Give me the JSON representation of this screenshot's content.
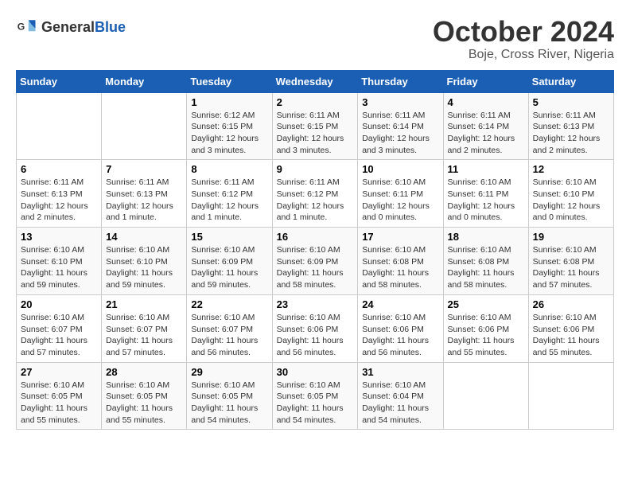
{
  "logo": {
    "general": "General",
    "blue": "Blue"
  },
  "title": "October 2024",
  "subtitle": "Boje, Cross River, Nigeria",
  "days_header": [
    "Sunday",
    "Monday",
    "Tuesday",
    "Wednesday",
    "Thursday",
    "Friday",
    "Saturday"
  ],
  "weeks": [
    [
      {
        "day": "",
        "info": ""
      },
      {
        "day": "",
        "info": ""
      },
      {
        "day": "1",
        "info": "Sunrise: 6:12 AM\nSunset: 6:15 PM\nDaylight: 12 hours and 3 minutes."
      },
      {
        "day": "2",
        "info": "Sunrise: 6:11 AM\nSunset: 6:15 PM\nDaylight: 12 hours and 3 minutes."
      },
      {
        "day": "3",
        "info": "Sunrise: 6:11 AM\nSunset: 6:14 PM\nDaylight: 12 hours and 3 minutes."
      },
      {
        "day": "4",
        "info": "Sunrise: 6:11 AM\nSunset: 6:14 PM\nDaylight: 12 hours and 2 minutes."
      },
      {
        "day": "5",
        "info": "Sunrise: 6:11 AM\nSunset: 6:13 PM\nDaylight: 12 hours and 2 minutes."
      }
    ],
    [
      {
        "day": "6",
        "info": "Sunrise: 6:11 AM\nSunset: 6:13 PM\nDaylight: 12 hours and 2 minutes."
      },
      {
        "day": "7",
        "info": "Sunrise: 6:11 AM\nSunset: 6:13 PM\nDaylight: 12 hours and 1 minute."
      },
      {
        "day": "8",
        "info": "Sunrise: 6:11 AM\nSunset: 6:12 PM\nDaylight: 12 hours and 1 minute."
      },
      {
        "day": "9",
        "info": "Sunrise: 6:11 AM\nSunset: 6:12 PM\nDaylight: 12 hours and 1 minute."
      },
      {
        "day": "10",
        "info": "Sunrise: 6:10 AM\nSunset: 6:11 PM\nDaylight: 12 hours and 0 minutes."
      },
      {
        "day": "11",
        "info": "Sunrise: 6:10 AM\nSunset: 6:11 PM\nDaylight: 12 hours and 0 minutes."
      },
      {
        "day": "12",
        "info": "Sunrise: 6:10 AM\nSunset: 6:10 PM\nDaylight: 12 hours and 0 minutes."
      }
    ],
    [
      {
        "day": "13",
        "info": "Sunrise: 6:10 AM\nSunset: 6:10 PM\nDaylight: 11 hours and 59 minutes."
      },
      {
        "day": "14",
        "info": "Sunrise: 6:10 AM\nSunset: 6:10 PM\nDaylight: 11 hours and 59 minutes."
      },
      {
        "day": "15",
        "info": "Sunrise: 6:10 AM\nSunset: 6:09 PM\nDaylight: 11 hours and 59 minutes."
      },
      {
        "day": "16",
        "info": "Sunrise: 6:10 AM\nSunset: 6:09 PM\nDaylight: 11 hours and 58 minutes."
      },
      {
        "day": "17",
        "info": "Sunrise: 6:10 AM\nSunset: 6:08 PM\nDaylight: 11 hours and 58 minutes."
      },
      {
        "day": "18",
        "info": "Sunrise: 6:10 AM\nSunset: 6:08 PM\nDaylight: 11 hours and 58 minutes."
      },
      {
        "day": "19",
        "info": "Sunrise: 6:10 AM\nSunset: 6:08 PM\nDaylight: 11 hours and 57 minutes."
      }
    ],
    [
      {
        "day": "20",
        "info": "Sunrise: 6:10 AM\nSunset: 6:07 PM\nDaylight: 11 hours and 57 minutes."
      },
      {
        "day": "21",
        "info": "Sunrise: 6:10 AM\nSunset: 6:07 PM\nDaylight: 11 hours and 57 minutes."
      },
      {
        "day": "22",
        "info": "Sunrise: 6:10 AM\nSunset: 6:07 PM\nDaylight: 11 hours and 56 minutes."
      },
      {
        "day": "23",
        "info": "Sunrise: 6:10 AM\nSunset: 6:06 PM\nDaylight: 11 hours and 56 minutes."
      },
      {
        "day": "24",
        "info": "Sunrise: 6:10 AM\nSunset: 6:06 PM\nDaylight: 11 hours and 56 minutes."
      },
      {
        "day": "25",
        "info": "Sunrise: 6:10 AM\nSunset: 6:06 PM\nDaylight: 11 hours and 55 minutes."
      },
      {
        "day": "26",
        "info": "Sunrise: 6:10 AM\nSunset: 6:06 PM\nDaylight: 11 hours and 55 minutes."
      }
    ],
    [
      {
        "day": "27",
        "info": "Sunrise: 6:10 AM\nSunset: 6:05 PM\nDaylight: 11 hours and 55 minutes."
      },
      {
        "day": "28",
        "info": "Sunrise: 6:10 AM\nSunset: 6:05 PM\nDaylight: 11 hours and 55 minutes."
      },
      {
        "day": "29",
        "info": "Sunrise: 6:10 AM\nSunset: 6:05 PM\nDaylight: 11 hours and 54 minutes."
      },
      {
        "day": "30",
        "info": "Sunrise: 6:10 AM\nSunset: 6:05 PM\nDaylight: 11 hours and 54 minutes."
      },
      {
        "day": "31",
        "info": "Sunrise: 6:10 AM\nSunset: 6:04 PM\nDaylight: 11 hours and 54 minutes."
      },
      {
        "day": "",
        "info": ""
      },
      {
        "day": "",
        "info": ""
      }
    ]
  ]
}
